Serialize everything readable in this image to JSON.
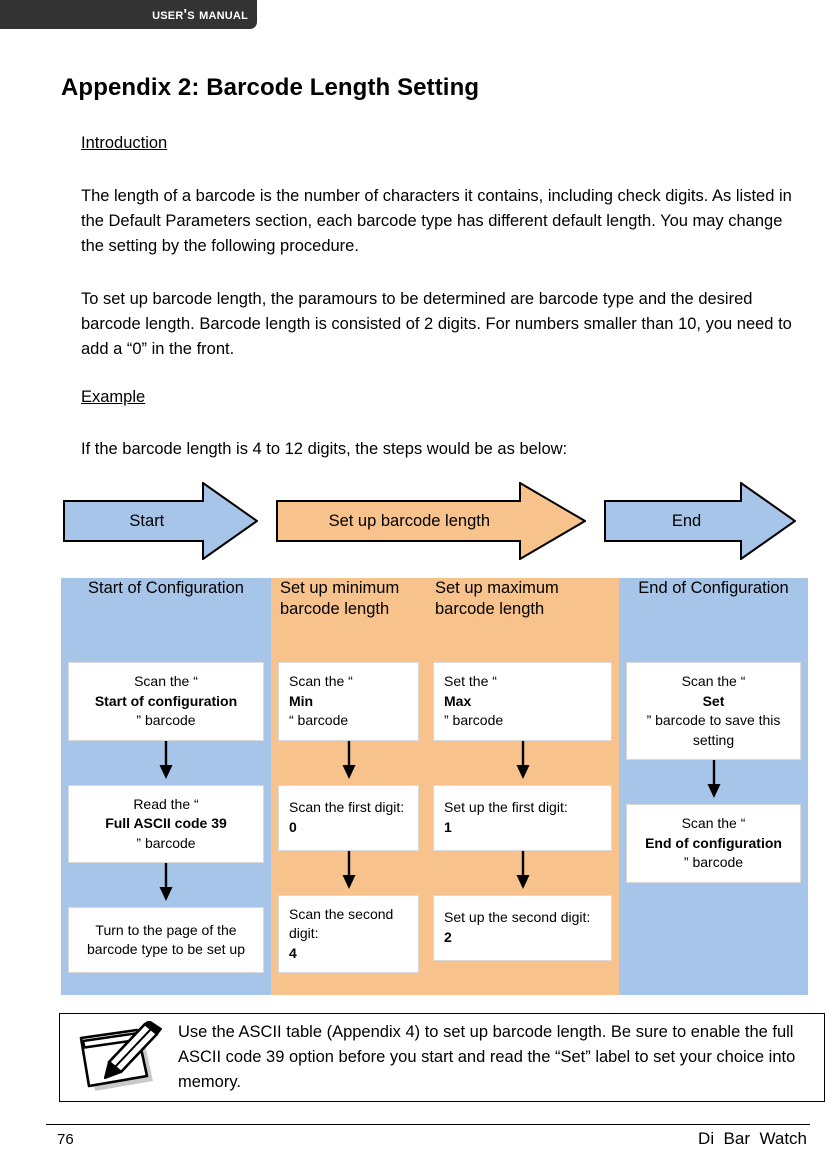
{
  "header": {
    "running_title": "User's Manual"
  },
  "page_title": "Appendix 2: Barcode Length Setting",
  "sections": {
    "introduction_heading": "Introduction",
    "introduction_paragraph": "The length of a barcode is the number of characters it contains, including check digits. As listed in the Default Parameters section, each barcode type has different default length. You may change the setting by the following procedure.",
    "setup_paragraph": "To set up barcode length, the paramours to be determined are barcode type and the desired barcode length. Barcode length is consisted of 2 digits. For numbers smaller than 10, you need to add a “0” in the front.",
    "example_heading": "Example",
    "example_paragraph": "If the barcode length is 4 to 12 digits, the steps would be as below:"
  },
  "arrow_banner": {
    "arrows": [
      {
        "label": "Start",
        "color": "#A7C5E8",
        "name": "arrow-start"
      },
      {
        "label": "Set up barcode length",
        "color": "#F7C28B",
        "name": "arrow-middle"
      },
      {
        "label": "End",
        "color": "#A7C5E8",
        "name": "arrow-end"
      }
    ]
  },
  "flow_table": {
    "headers": [
      {
        "label": "Start of Configuration",
        "color": "#A7C5E8"
      },
      {
        "label": "Set up minimum barcode length",
        "color": "#F7C28B"
      },
      {
        "label": "Set up maximum barcode length",
        "color": "#F7C28B"
      },
      {
        "label": "End of Configuration",
        "color": "#A7C5E8"
      }
    ],
    "columns": [
      {
        "color": "#A7C5E8",
        "align": "c",
        "steps": [
          {
            "html": "Scan the “<b>Start of configuration</b>” barcode"
          },
          {
            "html": "Read the “<b>Full ASCII code 39</b>” barcode"
          },
          {
            "html": "Turn to the page of the barcode type to be set up"
          }
        ]
      },
      {
        "color": "#F7C28B",
        "align": "l",
        "steps": [
          {
            "html": "Scan the “<b>Min</b>“ barcode"
          },
          {
            "html": "Scan the first digit: <b>0</b>"
          },
          {
            "html": "Scan the second digit: <b>4</b>"
          }
        ]
      },
      {
        "color": "#F7C28B",
        "align": "l",
        "steps": [
          {
            "html": "Set the “<b>Max</b>” barcode"
          },
          {
            "html": "Set up the first digit: <b>1</b>"
          },
          {
            "html": "Set up the second digit: <b>2</b>"
          }
        ]
      },
      {
        "color": "#A7C5E8",
        "align": "c",
        "steps": [
          {
            "html": "Scan the “<b>Set</b>” barcode to save this setting"
          },
          {
            "html": "Scan the “<b>End of configuration</b>” barcode"
          }
        ]
      }
    ]
  },
  "note": {
    "icon": "notepad-pencil-icon",
    "text": "Use the ASCII table (Appendix 4) to set up barcode length. Be sure to enable the full ASCII code 39 option before you start and read the “Set” label to set your choice into memory."
  },
  "footer": {
    "page_number": "76",
    "brand": "Di  Bar  Watch"
  }
}
